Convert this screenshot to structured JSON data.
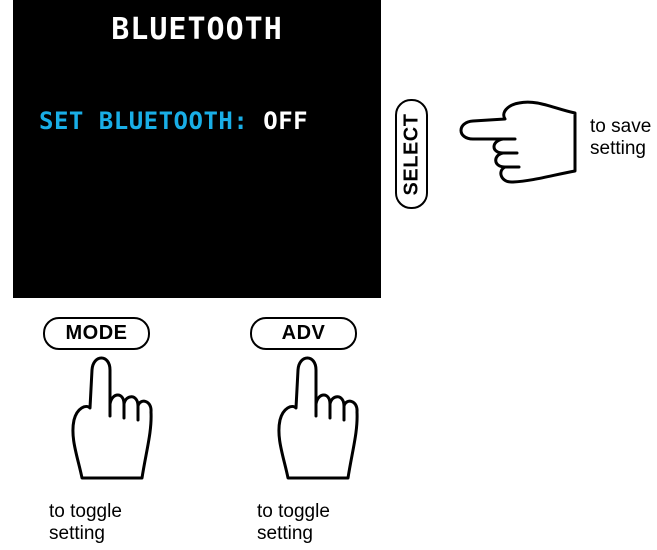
{
  "screen": {
    "title": "BLUETOOTH",
    "setting_label": "SET BLUETOOTH:",
    "setting_value": "OFF"
  },
  "buttons": {
    "mode": "MODE",
    "adv": "ADV",
    "select": "SELECT"
  },
  "hints": {
    "mode": [
      "to toggle",
      "setting"
    ],
    "adv": [
      "to toggle",
      "setting"
    ],
    "select": [
      "to save",
      "setting"
    ]
  },
  "colors": {
    "screen_background": "#000000",
    "label_accent": "#19aee6",
    "value_text": "#ffffff"
  }
}
